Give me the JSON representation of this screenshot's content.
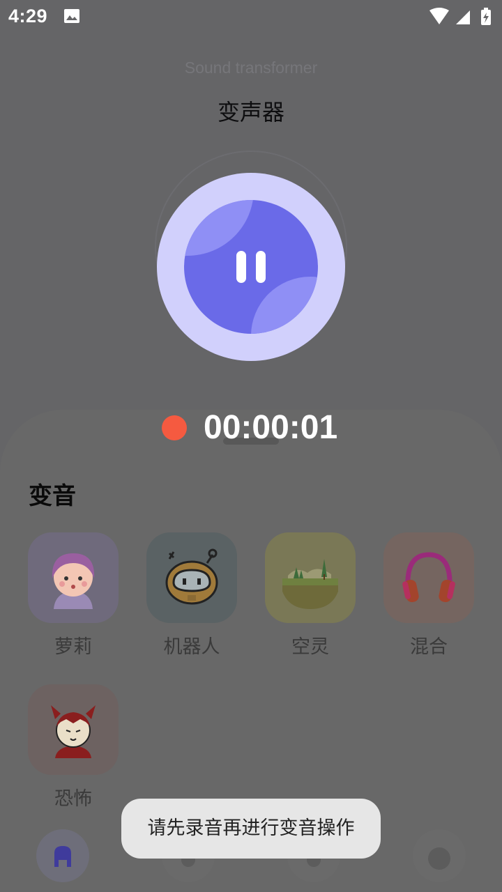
{
  "status_bar": {
    "time": "4:29",
    "icons": [
      "image-icon",
      "wifi-icon",
      "signal-icon",
      "battery-charging-icon"
    ]
  },
  "header": {
    "subtitle": "Sound transformer",
    "title": "变声器"
  },
  "recorder": {
    "button_icon": "pause-icon",
    "timer": "00:00:01",
    "indicator_color": "#f55a40"
  },
  "effects": {
    "section_title": "变音",
    "items": [
      {
        "label": "萝莉",
        "icon": "girl-avatar-icon",
        "tile_color": "#6f6a7c"
      },
      {
        "label": "机器人",
        "icon": "robot-icon",
        "tile_color": "#5a6264"
      },
      {
        "label": "空灵",
        "icon": "landscape-icon",
        "tile_color": "#7a7856"
      },
      {
        "label": "混合",
        "icon": "headphones-icon",
        "tile_color": "#756560"
      },
      {
        "label": "恐怖",
        "icon": "devil-icon",
        "tile_color": "#6d6261"
      }
    ]
  },
  "bottom_nav": {
    "items": [
      "home-icon",
      "nav-icon-2",
      "nav-icon-3",
      "profile-icon"
    ]
  },
  "toast": {
    "message": "请先录音再进行变音操作"
  },
  "colors": {
    "accent": "#6a6ae8",
    "accent_light": "#d1d0fc",
    "overlay": "#656567"
  }
}
